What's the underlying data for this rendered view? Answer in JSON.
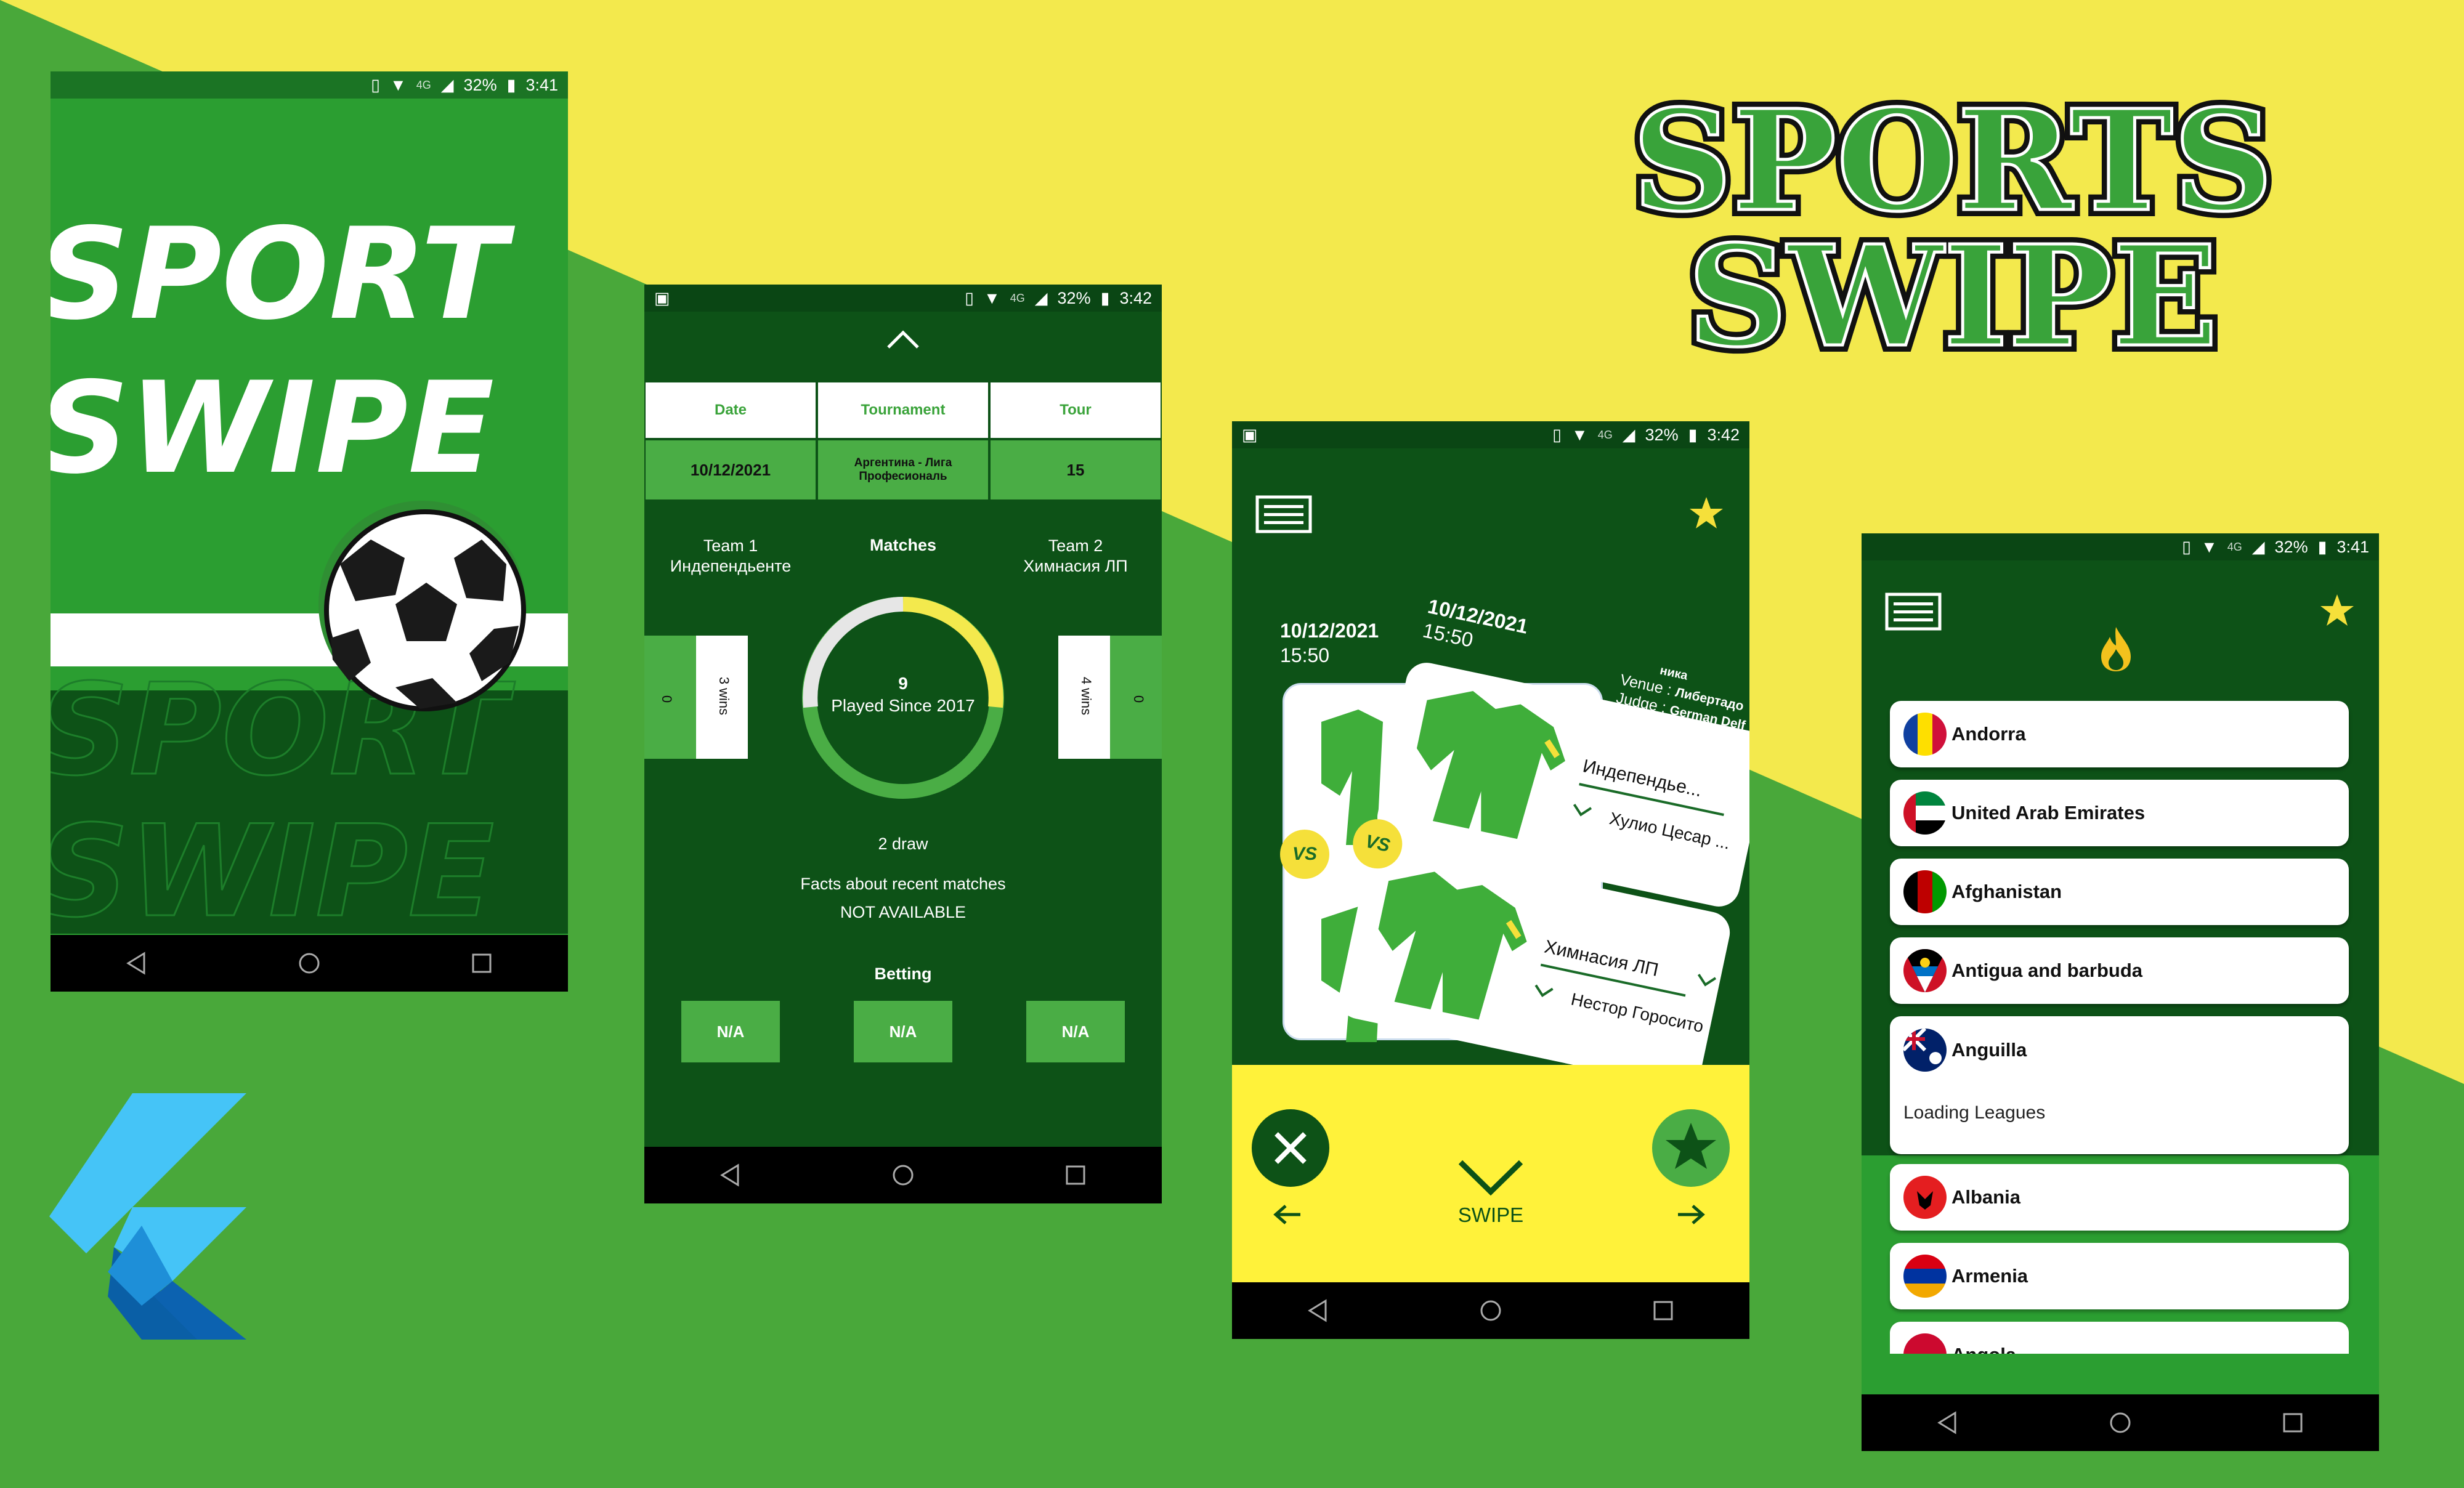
{
  "app_title_line1": "SPORTS",
  "app_title_line2": "SWIPE",
  "statusbar": {
    "screen1": {
      "network": "4G",
      "battery": "32%",
      "time": "3:41"
    },
    "screen2": {
      "network": "4G",
      "battery": "32%",
      "time": "3:42"
    },
    "screen3": {
      "network": "4G",
      "battery": "32%",
      "time": "3:42"
    },
    "screen4": {
      "network": "4G",
      "battery": "32%",
      "time": "3:41"
    }
  },
  "splash": {
    "line1": "SPORT",
    "line2": "SWIPE",
    "bg_line1": "SPORT",
    "bg_line2": "SWIPE"
  },
  "match_details": {
    "headers": [
      "Date",
      "Tournament",
      "Tour"
    ],
    "values": [
      "10/12/2021",
      "Аргентина - Лига Професиональ",
      "15"
    ],
    "team1_label": "Team 1",
    "team1_name": "Индепендьенте",
    "matches_label": "Matches",
    "team2_label": "Team 2",
    "team2_name": "Химнасия ЛП",
    "team1_wins": "3 wins",
    "team1_score": "0",
    "team2_wins": "4 wins",
    "team2_score": "0",
    "matches_count": "9",
    "played_since": "Played Since 2017",
    "draws": "2 draw",
    "facts_label": "Facts about recent matches",
    "facts_value": "NOT AVAILABLE",
    "betting_label": "Betting",
    "betting": [
      "N/A",
      "N/A",
      "N/A"
    ]
  },
  "swipe_screen": {
    "back_card": {
      "date": "10/12/2021",
      "time": "15:50"
    },
    "front_card": {
      "date": "10/12/2021",
      "time": "15:50",
      "venue_label": "Venue :",
      "venue_value": "Либертадо",
      "venue_top": "ника",
      "judge_label": "Judge :",
      "judge_value": "German Delf",
      "team1": "Индепендье...",
      "player1": "Хулио Цесар ...",
      "team2": "Химнасия ЛП",
      "player2": "Нестор Горосито",
      "vs": "VS"
    },
    "swipe_label": "SWIPE"
  },
  "leagues": {
    "countries": [
      "Andorra",
      "United Arab Emirates",
      "Afghanistan",
      "Antigua and barbuda",
      "Anguilla",
      "Albania",
      "Armenia",
      "Angola"
    ],
    "loading_text": "Loading Leagues"
  },
  "colors": {
    "dark_green": "#0d5217",
    "mid_green": "#2b9e31",
    "light_green": "#4aad45",
    "yellow": "#f3e94d",
    "button_yellow": "#fff23a"
  },
  "icons": [
    "menu-icon",
    "star-icon",
    "fire-icon",
    "close-icon",
    "chevron-down-icon",
    "arrow-left-icon",
    "arrow-right-icon",
    "chevron-up-icon",
    "flutter-logo-icon"
  ]
}
